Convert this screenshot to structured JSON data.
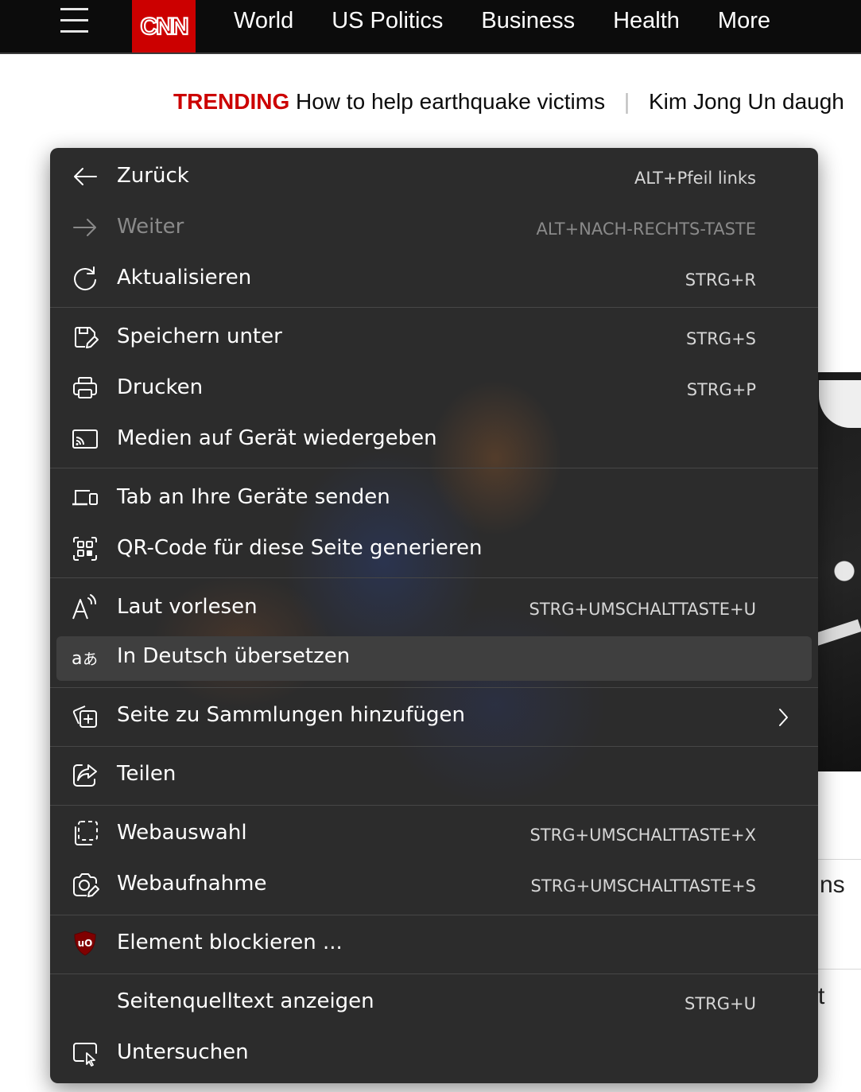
{
  "header": {
    "logo_text": "CNN",
    "nav": [
      "World",
      "US Politics",
      "Business",
      "Health",
      "More"
    ]
  },
  "trending": {
    "label": "TRENDING",
    "items": [
      "How to help earthquake victims",
      "Kim Jong Un daugh"
    ]
  },
  "background": {
    "frag1": "ns",
    "frag2": "t"
  },
  "menu": {
    "items": [
      {
        "label": "Zurück",
        "shortcut": "ALT+Pfeil links",
        "icon": "back-arrow-icon"
      },
      {
        "label": "Weiter",
        "shortcut": "ALT+NACH-RECHTS-TASTE",
        "icon": "forward-arrow-icon",
        "disabled": true
      },
      {
        "label": "Aktualisieren",
        "shortcut": "STRG+R",
        "icon": "refresh-icon"
      },
      {
        "label": "Speichern unter",
        "shortcut": "STRG+S",
        "icon": "save-as-icon"
      },
      {
        "label": "Drucken",
        "shortcut": "STRG+P",
        "icon": "printer-icon"
      },
      {
        "label": "Medien auf Gerät wiedergeben",
        "shortcut": "",
        "icon": "cast-icon"
      },
      {
        "label": "Tab an Ihre Geräte senden",
        "shortcut": "",
        "icon": "devices-icon"
      },
      {
        "label": "QR-Code für diese Seite generieren",
        "shortcut": "",
        "icon": "qr-code-icon"
      },
      {
        "label": "Laut vorlesen",
        "shortcut": "STRG+UMSCHALTTASTE+U",
        "icon": "read-aloud-icon"
      },
      {
        "label": "In Deutsch übersetzen",
        "shortcut": "",
        "icon": "translate-icon",
        "highlighted": true
      },
      {
        "label": "Seite zu Sammlungen hinzufügen",
        "shortcut": "",
        "icon": "collections-add-icon",
        "submenu": true
      },
      {
        "label": "Teilen",
        "shortcut": "",
        "icon": "share-icon"
      },
      {
        "label": "Webauswahl",
        "shortcut": "STRG+UMSCHALTTASTE+X",
        "icon": "web-select-icon"
      },
      {
        "label": "Webaufnahme",
        "shortcut": "STRG+UMSCHALTTASTE+S",
        "icon": "web-capture-icon"
      },
      {
        "label": "Element blockieren ...",
        "shortcut": "",
        "icon": "ublock-origin-icon"
      },
      {
        "label": "Seitenquelltext anzeigen",
        "shortcut": "STRG+U",
        "icon": ""
      },
      {
        "label": "Untersuchen",
        "shortcut": "",
        "icon": "inspect-icon"
      }
    ]
  },
  "colors": {
    "cnn_red": "#cc0000",
    "menu_bg": "#2c2c2c",
    "highlight": "#3f3f3f"
  }
}
